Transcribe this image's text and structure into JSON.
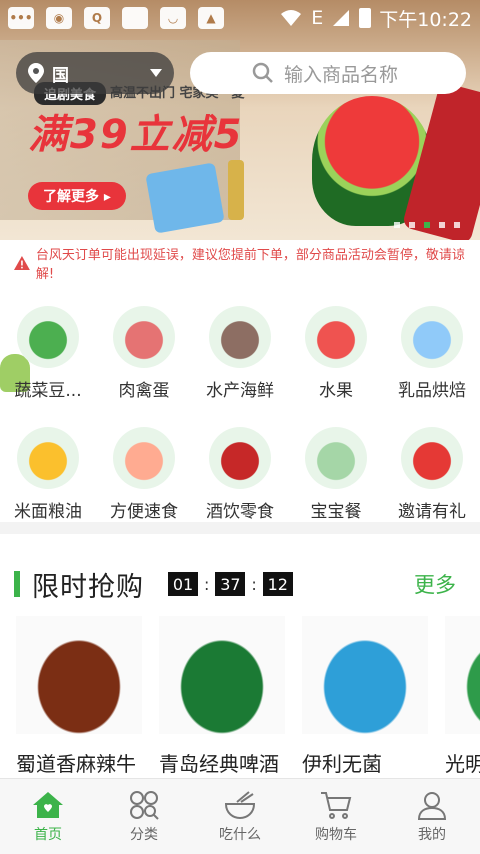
{
  "status_bar": {
    "time": "下午10:22",
    "network": "E"
  },
  "location": {
    "city": "国"
  },
  "search": {
    "placeholder": "输入商品名称"
  },
  "banner": {
    "tag": "追剧美食",
    "subtitle": "高温不出门 宅家美一夏",
    "headline": "满39立减5",
    "button": "了解更多 ▸",
    "page_count": 5,
    "active_page": 3
  },
  "notice": "台风天订单可能出现延误，建议您提前下单，部分商品活动会暂停，敬请谅解!",
  "categories": [
    {
      "label": "蔬菜豆...",
      "icon": "vegetables-icon",
      "color": "#4caf50"
    },
    {
      "label": "肉禽蛋",
      "icon": "meat-icon",
      "color": "#e57373"
    },
    {
      "label": "水产海鲜",
      "icon": "fish-icon",
      "color": "#8d6e63"
    },
    {
      "label": "水果",
      "icon": "watermelon-icon",
      "color": "#ef5350"
    },
    {
      "label": "乳品烘焙",
      "icon": "milk-icon",
      "color": "#90caf9"
    },
    {
      "label": "米面粮油",
      "icon": "oil-icon",
      "color": "#fbc02d"
    },
    {
      "label": "方便速食",
      "icon": "noodles-icon",
      "color": "#ffab91"
    },
    {
      "label": "酒饮零食",
      "icon": "drinks-icon",
      "color": "#c62828"
    },
    {
      "label": "宝宝餐",
      "icon": "baby-food-icon",
      "color": "#a5d6a7"
    },
    {
      "label": "邀请有礼",
      "icon": "gift-coupon-icon",
      "color": "#e53935"
    }
  ],
  "flash_sale": {
    "title": "限时抢购",
    "timer": {
      "hours": "01",
      "minutes": "37",
      "seconds": "12"
    },
    "more": "更多",
    "products": [
      {
        "name": "蜀道香麻辣牛",
        "icon": "beef-jerky-icon",
        "color": "#7b2e14"
      },
      {
        "name": "青岛经典啤酒",
        "icon": "beer-icon",
        "color": "#1b7a34"
      },
      {
        "name": "伊利无菌",
        "icon": "milk-box-icon",
        "color": "#2e9fd8"
      },
      {
        "name": "光明",
        "icon": "dairy-pack-icon",
        "color": "#2e9b4a"
      }
    ]
  },
  "tab_bar": [
    {
      "label": "首页",
      "icon": "home-icon",
      "active": true
    },
    {
      "label": "分类",
      "icon": "category-icon",
      "active": false
    },
    {
      "label": "吃什么",
      "icon": "bowl-icon",
      "active": false
    },
    {
      "label": "购物车",
      "icon": "cart-icon",
      "active": false
    },
    {
      "label": "我的",
      "icon": "user-icon",
      "active": false
    }
  ],
  "colors": {
    "brand_green": "#3cb34a",
    "promo_red": "#e8343b",
    "notice_red": "#e04a4a"
  }
}
